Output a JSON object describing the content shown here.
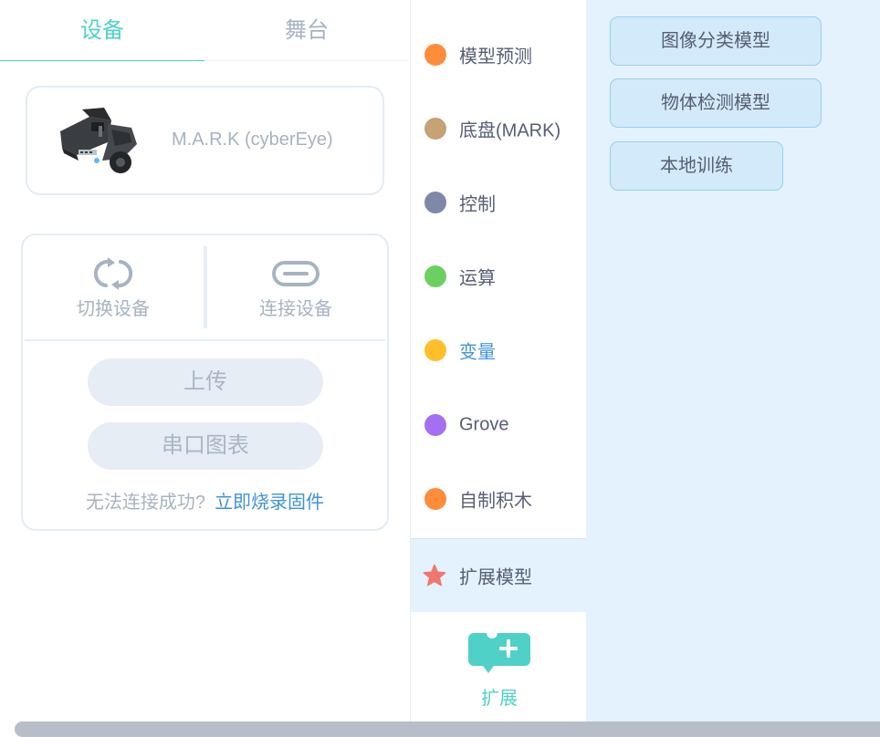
{
  "tabs": {
    "device": "设备",
    "stage": "舞台"
  },
  "device": {
    "name": "M.A.R.K (cyberEye)"
  },
  "actions": {
    "switch": "切换设备",
    "connect": "连接设备"
  },
  "buttons": {
    "upload": "上传",
    "serial_chart": "串口图表"
  },
  "help": {
    "text": "无法连接成功?",
    "link": "立即烧录固件"
  },
  "categories": [
    {
      "label": "模型预测",
      "color": "#ff8c3b"
    },
    {
      "label": "底盘(MARK)",
      "color": "#c6a274"
    },
    {
      "label": "控制",
      "color": "#7e89a8"
    },
    {
      "label": "运算",
      "color": "#6cd061"
    },
    {
      "label": "变量",
      "color": "#ffbf2b",
      "label_color": "#3f93d8"
    },
    {
      "label": "Grove",
      "color": "#a56ff1"
    },
    {
      "label": "自制积木",
      "color": "#ff8c3b"
    },
    {
      "label": "扩展模型",
      "color": "#f0776d",
      "icon": "star-icon"
    }
  ],
  "extend": {
    "label": "扩展",
    "icon": "add-extension-icon"
  },
  "palette": {
    "image_classification": "图像分类模型",
    "object_detection": "物体检测模型",
    "local_training": "本地训练"
  },
  "colors": {
    "accent": "#4fd1c8",
    "link": "#3f93d8",
    "palette_bg": "#e3f2fd"
  }
}
